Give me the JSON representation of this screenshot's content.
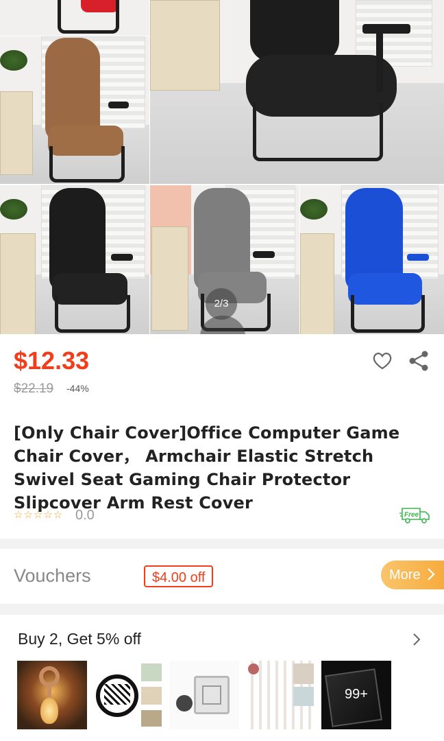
{
  "gallery": {
    "page_indicator": "2/3",
    "colors": {
      "brown": "#9b6a44",
      "black": "#1c1c1c",
      "gray": "#7e7e7e",
      "blue": "#1b4fd6",
      "red": "#d8202a"
    }
  },
  "product": {
    "price": "$12.33",
    "original_price": "$22.19",
    "discount": "-44%",
    "title": "[Only Chair Cover]Office Computer Game Chair Cover， Armchair Elastic Stretch Swivel Seat Gaming Chair Protector Slipcover Arm Rest Cover",
    "stars": "☆☆☆☆☆",
    "rating": "0.0",
    "free_shipping_label": "Free"
  },
  "vouchers": {
    "label": "Vouchers",
    "tag": "$4.00 off",
    "more_label": "More"
  },
  "promo": {
    "title": "Buy 2, Get 5% off",
    "more_count": "99+"
  },
  "colors": {
    "accent": "#f23c1a",
    "more_button": "#f7b048"
  }
}
